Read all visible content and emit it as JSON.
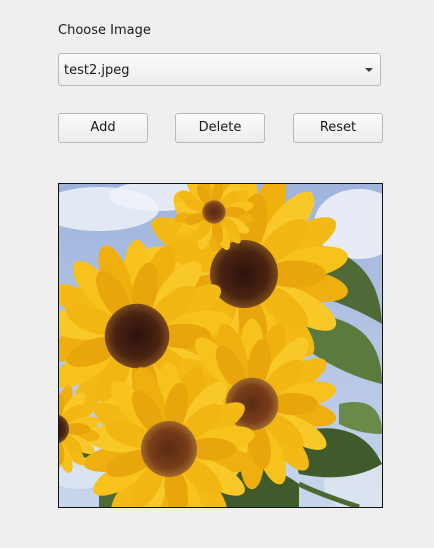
{
  "form": {
    "label": "Choose Image",
    "selected_image": "test2.jpeg"
  },
  "buttons": {
    "add": "Add",
    "delete": "Delete",
    "reset": "Reset"
  },
  "preview": {
    "icon": "sunflowers-image"
  },
  "colors": {
    "background": "#efefef",
    "sky": "#9eb5dc",
    "petal": "#f5c01a",
    "center": "#4a2312",
    "leaf": "#4f6a36"
  }
}
